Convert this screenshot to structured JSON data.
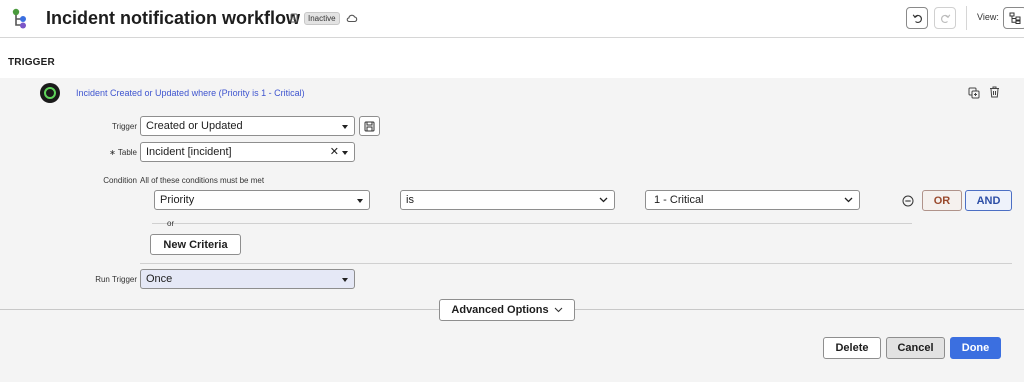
{
  "header": {
    "title": "Incident notification workflow",
    "status_badge": "Inactive",
    "view_label": "View:"
  },
  "trigger_section": {
    "title": "TRIGGER",
    "summary": "Incident Created or Updated where (Priority is 1 - Critical)",
    "trigger": {
      "label": "Trigger",
      "value": "Created or Updated"
    },
    "table": {
      "required_mark": "∗",
      "label": "Table",
      "value": "Incident [incident]",
      "clear_glyph": "✕"
    },
    "condition": {
      "label": "Condition",
      "hint": "All of these conditions must be met",
      "field": "Priority",
      "operator": "is",
      "value": "1 - Critical",
      "or_button": "OR",
      "and_button": "AND",
      "or_text": "or",
      "new_criteria_button": "New Criteria"
    },
    "run_trigger": {
      "label": "Run Trigger",
      "value": "Once"
    },
    "advanced_options_button": "Advanced Options"
  },
  "footer": {
    "delete_label": "Delete",
    "cancel_label": "Cancel",
    "done_label": "Done"
  },
  "colors": {
    "accent": "#3b6fe0",
    "link": "#3f55cf",
    "trigger_ring": "#5fd35a",
    "or_text": "#9a4a2d"
  }
}
